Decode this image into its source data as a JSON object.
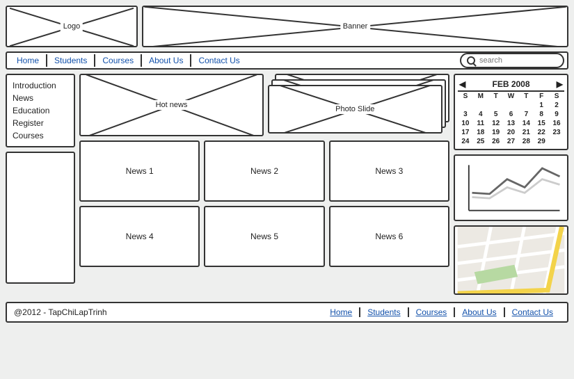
{
  "header": {
    "logo_label": "Logo",
    "banner_label": "Banner"
  },
  "nav": {
    "items": [
      "Home",
      "Students",
      "Courses",
      "About Us",
      "Contact Us"
    ],
    "search_placeholder": "search"
  },
  "sidebar": {
    "items": [
      "Introduction",
      "News",
      "Education",
      "Register",
      "Courses"
    ]
  },
  "content": {
    "hot_label": "Hot news",
    "photo_slide_label": "Photo Slide",
    "news_cards": [
      "News 1",
      "News 2",
      "News 3",
      "News 4",
      "News 5",
      "News 6"
    ]
  },
  "calendar": {
    "title": "FEB 2008",
    "dow": [
      "S",
      "M",
      "T",
      "W",
      "T",
      "F",
      "S"
    ],
    "days": [
      "",
      "",
      "",
      "",
      "",
      "1",
      "2",
      "3",
      "4",
      "5",
      "6",
      "7",
      "8",
      "9",
      "10",
      "11",
      "12",
      "13",
      "14",
      "15",
      "16",
      "17",
      "18",
      "19",
      "20",
      "21",
      "22",
      "23",
      "24",
      "25",
      "26",
      "27",
      "28",
      "29",
      ""
    ]
  },
  "chart_data": {
    "type": "line",
    "note": "schematic sparkline – no axes labels visible",
    "series": [
      {
        "name": "dark",
        "values": [
          30,
          28,
          55,
          40,
          75,
          60
        ]
      },
      {
        "name": "light",
        "values": [
          22,
          20,
          40,
          30,
          55,
          45
        ]
      }
    ]
  },
  "footer": {
    "copyright": "@2012 - TapChiLapTrinh",
    "links": [
      "Home",
      "Students",
      "Courses",
      "About Us",
      "Contact Us"
    ]
  }
}
